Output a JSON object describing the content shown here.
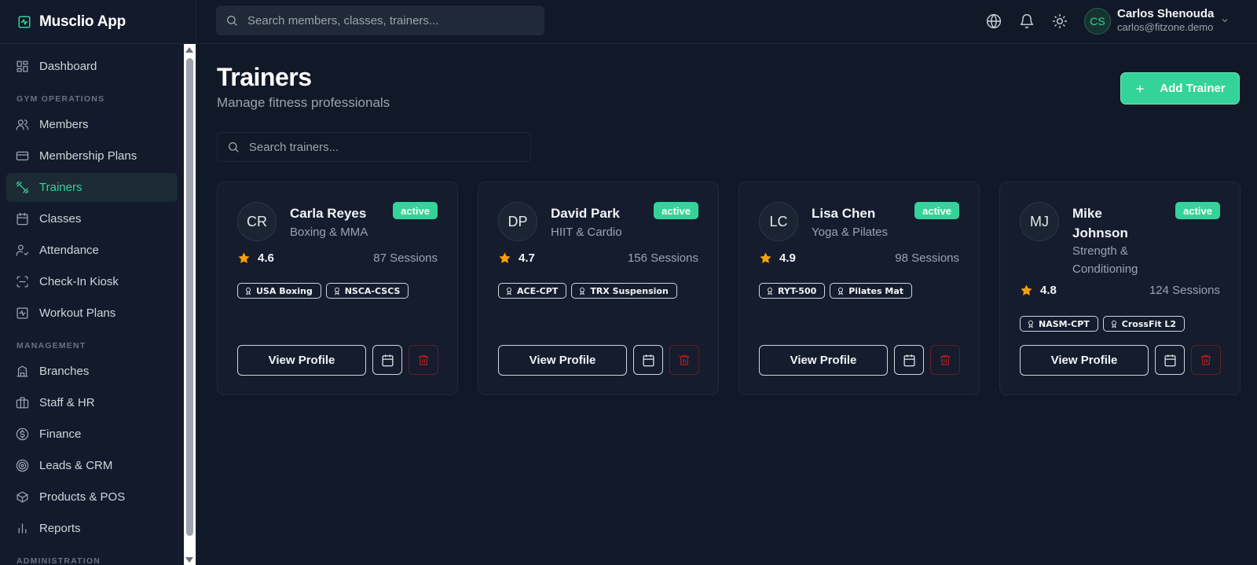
{
  "app": {
    "title": "Musclio App"
  },
  "sidebar": {
    "items": [
      {
        "label": "Dashboard",
        "icon": "dashboard-icon"
      },
      {
        "section": "GYM OPERATIONS"
      },
      {
        "label": "Members",
        "icon": "users-icon"
      },
      {
        "label": "Membership Plans",
        "icon": "card-icon"
      },
      {
        "label": "Trainers",
        "icon": "dumbbell-icon",
        "active": true
      },
      {
        "label": "Classes",
        "icon": "calendar-icon"
      },
      {
        "label": "Attendance",
        "icon": "user-check-icon"
      },
      {
        "label": "Check-In Kiosk",
        "icon": "scan-icon"
      },
      {
        "label": "Workout Plans",
        "icon": "activity-icon"
      },
      {
        "section": "MANAGEMENT"
      },
      {
        "label": "Branches",
        "icon": "building-icon"
      },
      {
        "label": "Staff & HR",
        "icon": "briefcase-icon"
      },
      {
        "label": "Finance",
        "icon": "dollar-icon"
      },
      {
        "label": "Leads & CRM",
        "icon": "target-icon"
      },
      {
        "label": "Products & POS",
        "icon": "package-icon"
      },
      {
        "label": "Reports",
        "icon": "bar-chart-icon"
      },
      {
        "section": "ADMINISTRATION"
      }
    ]
  },
  "topbar": {
    "search_placeholder": "Search members, classes, trainers...",
    "user": {
      "initials": "CS",
      "name": "Carlos Shenouda",
      "email": "carlos@fitzone.demo"
    }
  },
  "page": {
    "title": "Trainers",
    "subtitle": "Manage fitness professionals",
    "add_label": "Add Trainer",
    "search_placeholder": "Search trainers..."
  },
  "trainers": [
    {
      "initials": "CR",
      "name": "Carla Reyes",
      "specialty": "Boxing & MMA",
      "status": "active",
      "rating": "4.6",
      "sessions": "87 Sessions",
      "certs": [
        "USA Boxing",
        "NSCA-CSCS"
      ],
      "view_label": "View Profile"
    },
    {
      "initials": "DP",
      "name": "David Park",
      "specialty": "HIIT & Cardio",
      "status": "active",
      "rating": "4.7",
      "sessions": "156 Sessions",
      "certs": [
        "ACE-CPT",
        "TRX Suspension"
      ],
      "view_label": "View Profile"
    },
    {
      "initials": "LC",
      "name": "Lisa Chen",
      "specialty": "Yoga & Pilates",
      "status": "active",
      "rating": "4.9",
      "sessions": "98 Sessions",
      "certs": [
        "RYT-500",
        "Pilates Mat"
      ],
      "view_label": "View Profile"
    },
    {
      "initials": "MJ",
      "name": "Mike Johnson",
      "specialty": "Strength & Conditioning",
      "status": "active",
      "rating": "4.8",
      "sessions": "124 Sessions",
      "certs": [
        "NASM-CPT",
        "CrossFit L2"
      ],
      "view_label": "View Profile"
    }
  ],
  "colors": {
    "accent": "#34d399",
    "background": "#111827",
    "sidebar": "#121a2b",
    "card": "#141c2e",
    "star": "#f59e0b",
    "danger": "#b91c1c"
  }
}
